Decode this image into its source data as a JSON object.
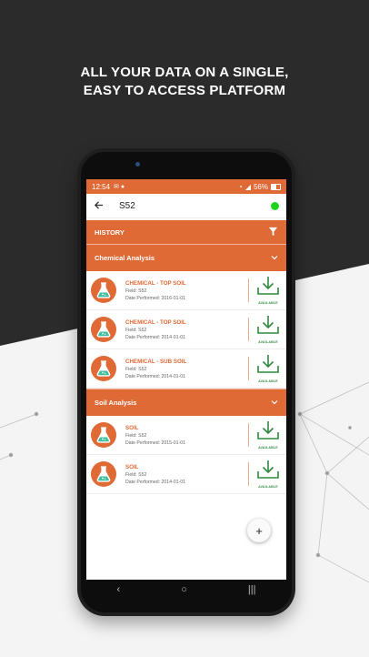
{
  "headline": {
    "line1": "ALL YOUR DATA ON A SINGLE,",
    "line2": "EASY TO ACCESS PLATFORM"
  },
  "status_bar": {
    "time": "12:54",
    "battery": "56%"
  },
  "app_bar": {
    "title": "S52",
    "status_color": "#1ed31e"
  },
  "history_bar": {
    "label": "HISTORY"
  },
  "sections": [
    {
      "title": "Chemical Analysis",
      "items": [
        {
          "name": "CHEMICAL - TOP SOIL",
          "field": "Field: S52",
          "date": "Date Performed: 2016-01-01",
          "status": "AVAILABLE"
        },
        {
          "name": "CHEMICAL - TOP SOIL",
          "field": "Field: S52",
          "date": "Date Performed: 2014-01-01",
          "status": "AVAILABLE"
        },
        {
          "name": "CHEMICAL - SUB SOIL",
          "field": "Field: S52",
          "date": "Date Performed: 2014-01-01",
          "status": "AVAILABLE"
        }
      ]
    },
    {
      "title": "Soil Analysis",
      "items": [
        {
          "name": "SOIL",
          "field": "Field: S52",
          "date": "Date Performed: 2015-01-01",
          "status": "AVAILABLE"
        },
        {
          "name": "SOIL",
          "field": "Field: S52",
          "date": "Date Performed: 2014-01-01",
          "status": "AVAILABLE"
        }
      ]
    }
  ],
  "fab": {
    "label": "+"
  },
  "nav_bar": {
    "back": "‹",
    "home": "○",
    "recents": "|||"
  },
  "colors": {
    "accent": "#e06a36",
    "download": "#2e8b3e"
  },
  "icons": {
    "flask": "flask-icon",
    "download": "download-icon",
    "filter": "filter-icon",
    "back": "back-arrow-icon",
    "chevron": "chevron-down-icon"
  }
}
